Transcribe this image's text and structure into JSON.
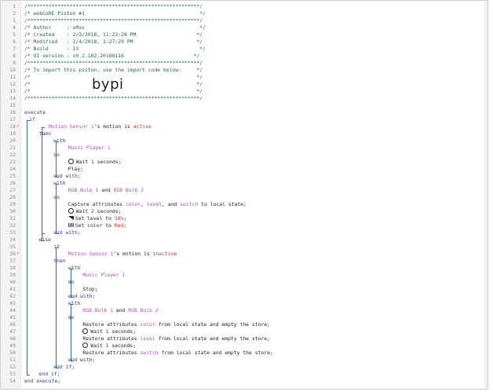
{
  "header": {
    "border": "/*********************************************************/",
    "title": "/* webCoRE Piston #1                                      */",
    "author": "/* Author     : xMav                                      */",
    "created": "/* Created    : 2/3/2018, 11:23:28 PM                    */",
    "modified": "/* Modified   : 2/4/2018, 1:27:29 PM                     */",
    "build": "/* Build      : 13                                        */",
    "ui_version": "/* UI version : v0.2.102.20180116                       */",
    "import_note": "/* To import this piston, use the import code below:     */",
    "blank1": "/*                                                       */",
    "blank2": "/*                                                       */",
    "blank3": "/*                                                       */",
    "import_code": "bypi"
  },
  "code": {
    "execute": "execute",
    "if": "if",
    "then": "then",
    "else": "else",
    "with": "with",
    "do": "do",
    "end_with": "end with;",
    "end_if": "end if;",
    "end_execute": "end execute;",
    "and": " and ",
    "motion_sensor": "Motion Sensor 1",
    "motion_suffix": "'s motion is ",
    "active": "active",
    "inactive": "inactive",
    "music_player": "Music Player 1",
    "bulb1": "RGB Bulb 1",
    "bulb2": "RGB Bulb 2",
    "wait_prefix": "Wait ",
    "wait1_val": "1",
    "wait2_val": "2",
    "wait_suffix": " seconds;",
    "play": "Play;",
    "stop": "Stop;",
    "capture_prefix": "Capture attributes ",
    "attr_color": "color",
    "attr_level": "level",
    "attr_switch": "switch",
    "comma": ", ",
    "and_word": ", and ",
    "capture_suffix": " to local state;",
    "set_level_prefix": "Set level to ",
    "set_level_val": "50%",
    "set_color_prefix": "Set color to ",
    "set_color_val": "Red",
    "semicolon": ";",
    "restore_prefix": "Restore attributes ",
    "restore_suffix": " from local state and empty the store;"
  },
  "line_numbers": [
    "1",
    "2",
    "3",
    "4",
    "5",
    "6",
    "7",
    "8",
    "9",
    "10",
    "11",
    "12",
    "13",
    "14",
    "15",
    "16",
    "17",
    "18",
    "19",
    "20",
    "21",
    "22",
    "23",
    "24",
    "25",
    "26",
    "27",
    "28",
    "29",
    "30",
    "31",
    "32",
    "33",
    "34",
    "35",
    "36",
    "37",
    "38",
    "39",
    "40",
    "41",
    "42",
    "43",
    "44",
    "45",
    "46",
    "47",
    "48",
    "49",
    "50",
    "51",
    "52",
    "53",
    "54"
  ],
  "marks": {
    "line18": "↑",
    "line36": "↑"
  },
  "colors": {
    "comment": "#1f6b3a",
    "keyword": "#2b3a8f",
    "device": "#b34bbf",
    "value": "#cc3333",
    "guide": "#2e6da4"
  },
  "icons": {
    "wait": "clock-icon",
    "level": "level-icon",
    "color": "palette-icon",
    "trigger": "lightning-icon"
  }
}
